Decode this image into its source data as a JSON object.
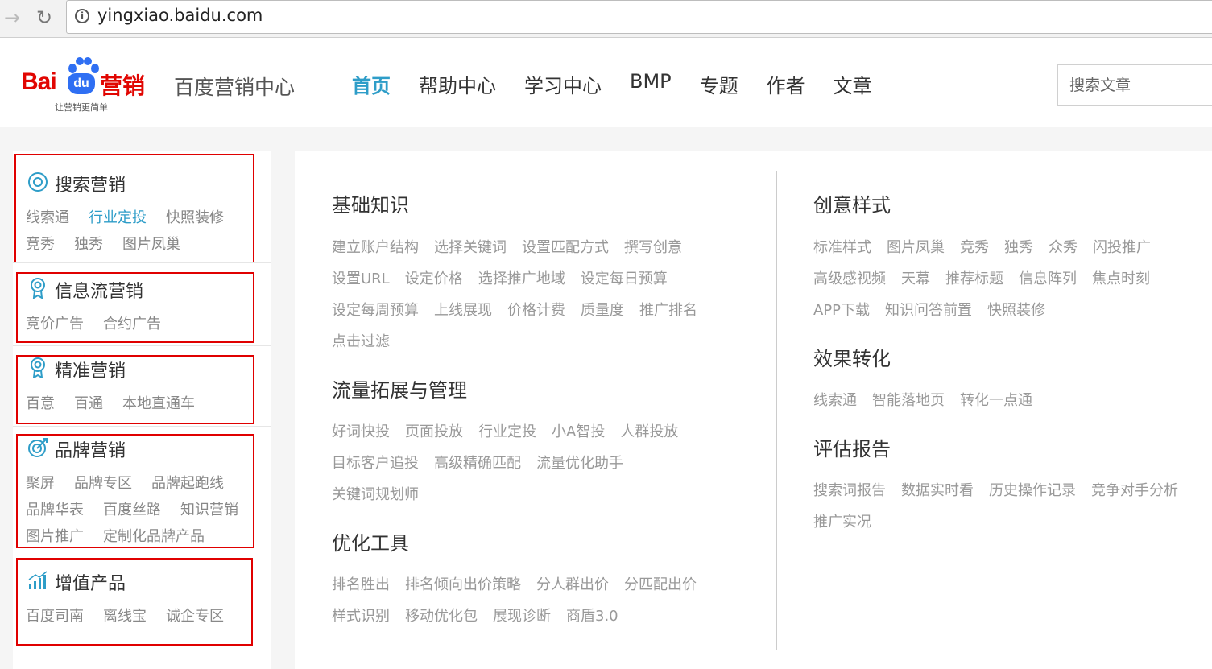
{
  "browser": {
    "url": "yingxiao.baidu.com"
  },
  "header": {
    "logo": {
      "bai": "Bai",
      "du": "du",
      "yingxiao": "营销",
      "slogan": "让营销更简单"
    },
    "site_name": "百度营销中心",
    "nav": [
      "首页",
      "帮助中心",
      "学习中心",
      "BMP",
      "专题",
      "作者",
      "文章"
    ],
    "active_nav": "首页",
    "search_placeholder": "搜索文章"
  },
  "sidebar": [
    {
      "title": "搜索营销",
      "icon": "search-icon",
      "rows": [
        [
          "线索通",
          "行业定投",
          "快照装修"
        ],
        [
          "竞秀",
          "独秀",
          "图片凤巢"
        ]
      ],
      "highlight": "行业定投"
    },
    {
      "title": "信息流营销",
      "icon": "badge-icon",
      "rows": [
        [
          "竞价广告",
          "合约广告"
        ]
      ]
    },
    {
      "title": "精准营销",
      "icon": "badge-icon",
      "rows": [
        [
          "百意",
          "百通",
          "本地直通车"
        ]
      ]
    },
    {
      "title": "品牌营销",
      "icon": "target-icon",
      "rows": [
        [
          "聚屏",
          "品牌专区",
          "品牌起跑线"
        ],
        [
          "品牌华表",
          "百度丝路",
          "知识营销"
        ],
        [
          "图片推广",
          "定制化品牌产品"
        ]
      ]
    },
    {
      "title": "增值产品",
      "icon": "bar-chart-icon",
      "rows": [
        [
          "百度司南",
          "离线宝",
          "诚企专区"
        ]
      ]
    }
  ],
  "left_column": [
    {
      "title": "基础知识",
      "rows": [
        [
          "建立账户结构",
          "选择关键词",
          "设置匹配方式",
          "撰写创意"
        ],
        [
          "设置URL",
          "设定价格",
          "选择推广地域",
          "设定每日预算"
        ],
        [
          "设定每周预算",
          "上线展现",
          "价格计费",
          "质量度",
          "推广排名"
        ],
        [
          "点击过滤"
        ]
      ]
    },
    {
      "title": "流量拓展与管理",
      "rows": [
        [
          "好词快投",
          "页面投放",
          "行业定投",
          "小A智投",
          "人群投放"
        ],
        [
          "目标客户追投",
          "高级精确匹配",
          "流量优化助手"
        ],
        [
          "关键词规划师"
        ]
      ]
    },
    {
      "title": "优化工具",
      "rows": [
        [
          "排名胜出",
          "排名倾向出价策略",
          "分人群出价",
          "分匹配出价"
        ],
        [
          "样式识别",
          "移动优化包",
          "展现诊断",
          "商盾3.0"
        ]
      ]
    }
  ],
  "right_column": [
    {
      "title": "创意样式",
      "rows": [
        [
          "标准样式",
          "图片凤巢",
          "竞秀",
          "独秀",
          "众秀",
          "闪投推广"
        ],
        [
          "高级感视频",
          "天幕",
          "推荐标题",
          "信息阵列",
          "焦点时刻"
        ],
        [
          "APP下载",
          "知识问答前置",
          "快照装修"
        ]
      ]
    },
    {
      "title": "效果转化",
      "rows": [
        [
          "线索通",
          "智能落地页",
          "转化一点通"
        ]
      ]
    },
    {
      "title": "评估报告",
      "rows": [
        [
          "搜索词报告",
          "数据实时看",
          "历史操作记录",
          "竞争对手分析"
        ],
        [
          "推广实况"
        ]
      ]
    }
  ],
  "colors": {
    "accent": "#2e9dc8",
    "brand_red": "#e10602",
    "brand_blue": "#2f6ff3",
    "annotation_red": "#e00000"
  }
}
